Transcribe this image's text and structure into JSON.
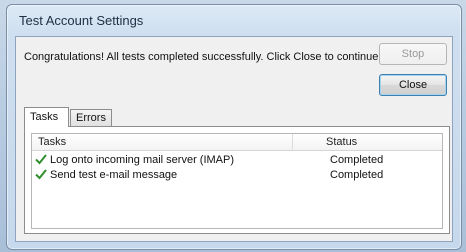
{
  "dialog": {
    "title": "Test Account Settings",
    "message": "Congratulations! All tests completed successfully. Click Close to continue.",
    "buttons": {
      "stop": "Stop",
      "close": "Close"
    }
  },
  "tabs": [
    {
      "label": "Tasks",
      "active": true
    },
    {
      "label": "Errors",
      "active": false
    }
  ],
  "table": {
    "columns": {
      "task": "Tasks",
      "status": "Status"
    },
    "rows": [
      {
        "task": "Log onto incoming mail server (IMAP)",
        "status": "Completed",
        "icon": "check-icon"
      },
      {
        "task": "Send test e-mail message",
        "status": "Completed",
        "icon": "check-icon"
      }
    ]
  },
  "colors": {
    "check": "#2f8f2f",
    "titlebar": "#cfdff0"
  }
}
